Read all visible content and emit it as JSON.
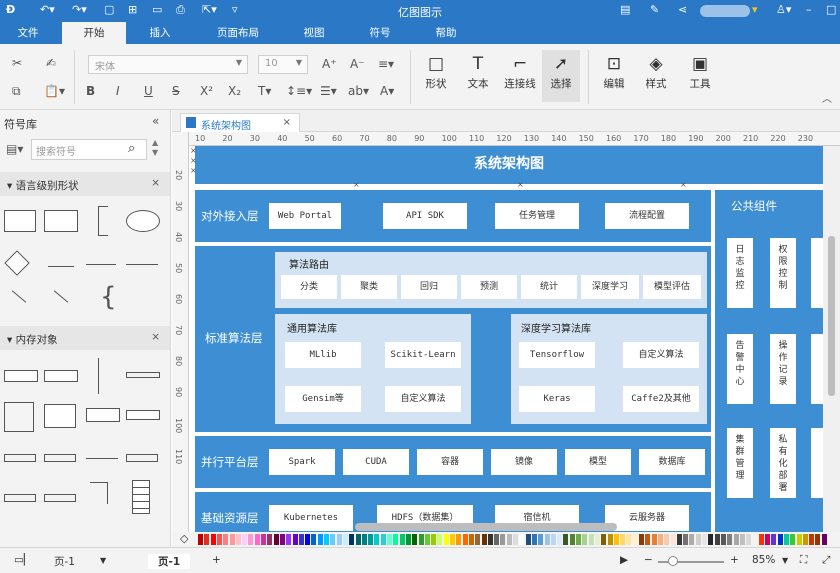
{
  "app": {
    "title": "亿图图示",
    "user_chip_suffix": "▾"
  },
  "menu": {
    "tabs": [
      "文件",
      "开始",
      "插入",
      "页面布局",
      "视图",
      "符号",
      "帮助"
    ],
    "active_tab": "开始"
  },
  "ribbon": {
    "font_name": "宋体",
    "font_size": "10",
    "groups": [
      "形状",
      "文本",
      "连接线",
      "选择",
      "编辑",
      "样式",
      "工具"
    ]
  },
  "left_panel": {
    "title": "符号库",
    "search_placeholder": "搜索符号",
    "sections": [
      "语言级别形状",
      "内存对象"
    ]
  },
  "doc_tab": {
    "label": "系统架构图"
  },
  "ruler": {
    "h_ticks": [
      "10",
      "20",
      "30",
      "40",
      "50",
      "60",
      "70",
      "80",
      "90",
      "100",
      "110",
      "120",
      "130",
      "140",
      "150",
      "160",
      "170",
      "180",
      "190",
      "200",
      "210",
      "220",
      "230"
    ],
    "v_ticks": [
      "20",
      "30",
      "40",
      "50",
      "60",
      "70",
      "80",
      "90",
      "100",
      "110"
    ]
  },
  "diagram": {
    "title": "系统架构图",
    "layers": [
      {
        "label": "对外接入层",
        "items": [
          "Web Portal",
          "API SDK",
          "任务管理",
          "流程配置"
        ]
      },
      {
        "label": "标准算法层"
      },
      {
        "label": "并行平台层",
        "items": [
          "Spark",
          "CUDA",
          "容器",
          "镜像",
          "模型",
          "数据库"
        ]
      },
      {
        "label": "基础资源层",
        "items": [
          "Kubernetes",
          "HDFS（数据集）",
          "宿信机",
          "云服务器"
        ]
      }
    ],
    "routing": {
      "title": "算法路由",
      "items": [
        "分类",
        "聚类",
        "回归",
        "预测",
        "统计",
        "深度学习",
        "模型评估"
      ]
    },
    "general": {
      "title": "通用算法库",
      "items": [
        "MLlib",
        "Scikit-Learn",
        "Gensim等",
        "自定义算法"
      ]
    },
    "deep": {
      "title": "深度学习算法库",
      "items": [
        "Tensorflow",
        "自定义算法",
        "Keras",
        "Caffe2及其他"
      ]
    },
    "common": {
      "title": "公共组件",
      "items": [
        "日志监控",
        "权限控制",
        "告警中心",
        "操作记录",
        "集群管理",
        "私有化部署"
      ]
    }
  },
  "status": {
    "page_selector": "页-1",
    "page_tab": "页-1",
    "add_page": "+",
    "zoom": "85%"
  },
  "palette_colors": [
    "#c00000",
    "#e0301e",
    "#ff0000",
    "#ff5050",
    "#ff7c80",
    "#ff9999",
    "#ffc0cb",
    "#ffccff",
    "#ff99cc",
    "#ff66cc",
    "#cc3399",
    "#993366",
    "#660033",
    "#800080",
    "#9933ff",
    "#6600cc",
    "#3333cc",
    "#0000ff",
    "#0066cc",
    "#0099ff",
    "#00ccff",
    "#66ccff",
    "#99ccff",
    "#ccecff",
    "#003366",
    "#006666",
    "#008080",
    "#009999",
    "#00cccc",
    "#33cccc",
    "#66ffcc",
    "#00ff99",
    "#00cc66",
    "#009933",
    "#006600",
    "#339933",
    "#66cc33",
    "#99cc00",
    "#ccff66",
    "#ffff00",
    "#ffcc00",
    "#ff9900",
    "#ff6600",
    "#cc6600",
    "#996633",
    "#663300",
    "#333333",
    "#666666",
    "#999999",
    "#bbbbbb",
    "#dddddd",
    "#ffffff",
    "#1f4e79",
    "#2e75b6",
    "#5b9bd5",
    "#9dc3e6",
    "#bdd7ee",
    "#deebf7",
    "#385723",
    "#548235",
    "#70ad47",
    "#a9d18e",
    "#c5e0b4",
    "#e2f0d9",
    "#7f6000",
    "#bf9000",
    "#ffc000",
    "#ffd966",
    "#ffe699",
    "#fff2cc",
    "#843c0c",
    "#c55a11",
    "#ed7d31",
    "#f4b183",
    "#f8cbad",
    "#fbe5d6",
    "#3a3838",
    "#757171",
    "#aeaaaa",
    "#d0cece",
    "#e7e6e6",
    "#262626",
    "#404040",
    "#595959",
    "#7f7f7f",
    "#a6a6a6",
    "#bfbfbf",
    "#d9d9d9",
    "#f2f2f2",
    "#ff3300",
    "#cc0066",
    "#6633cc",
    "#0033cc",
    "#00cc99",
    "#33cc33",
    "#cccc00",
    "#cc9900",
    "#cc3300",
    "#993300",
    "#660066"
  ],
  "colors": {
    "brand": "#2b79c6",
    "layer": "#3d8ed3",
    "panel": "#d3e3f4"
  }
}
